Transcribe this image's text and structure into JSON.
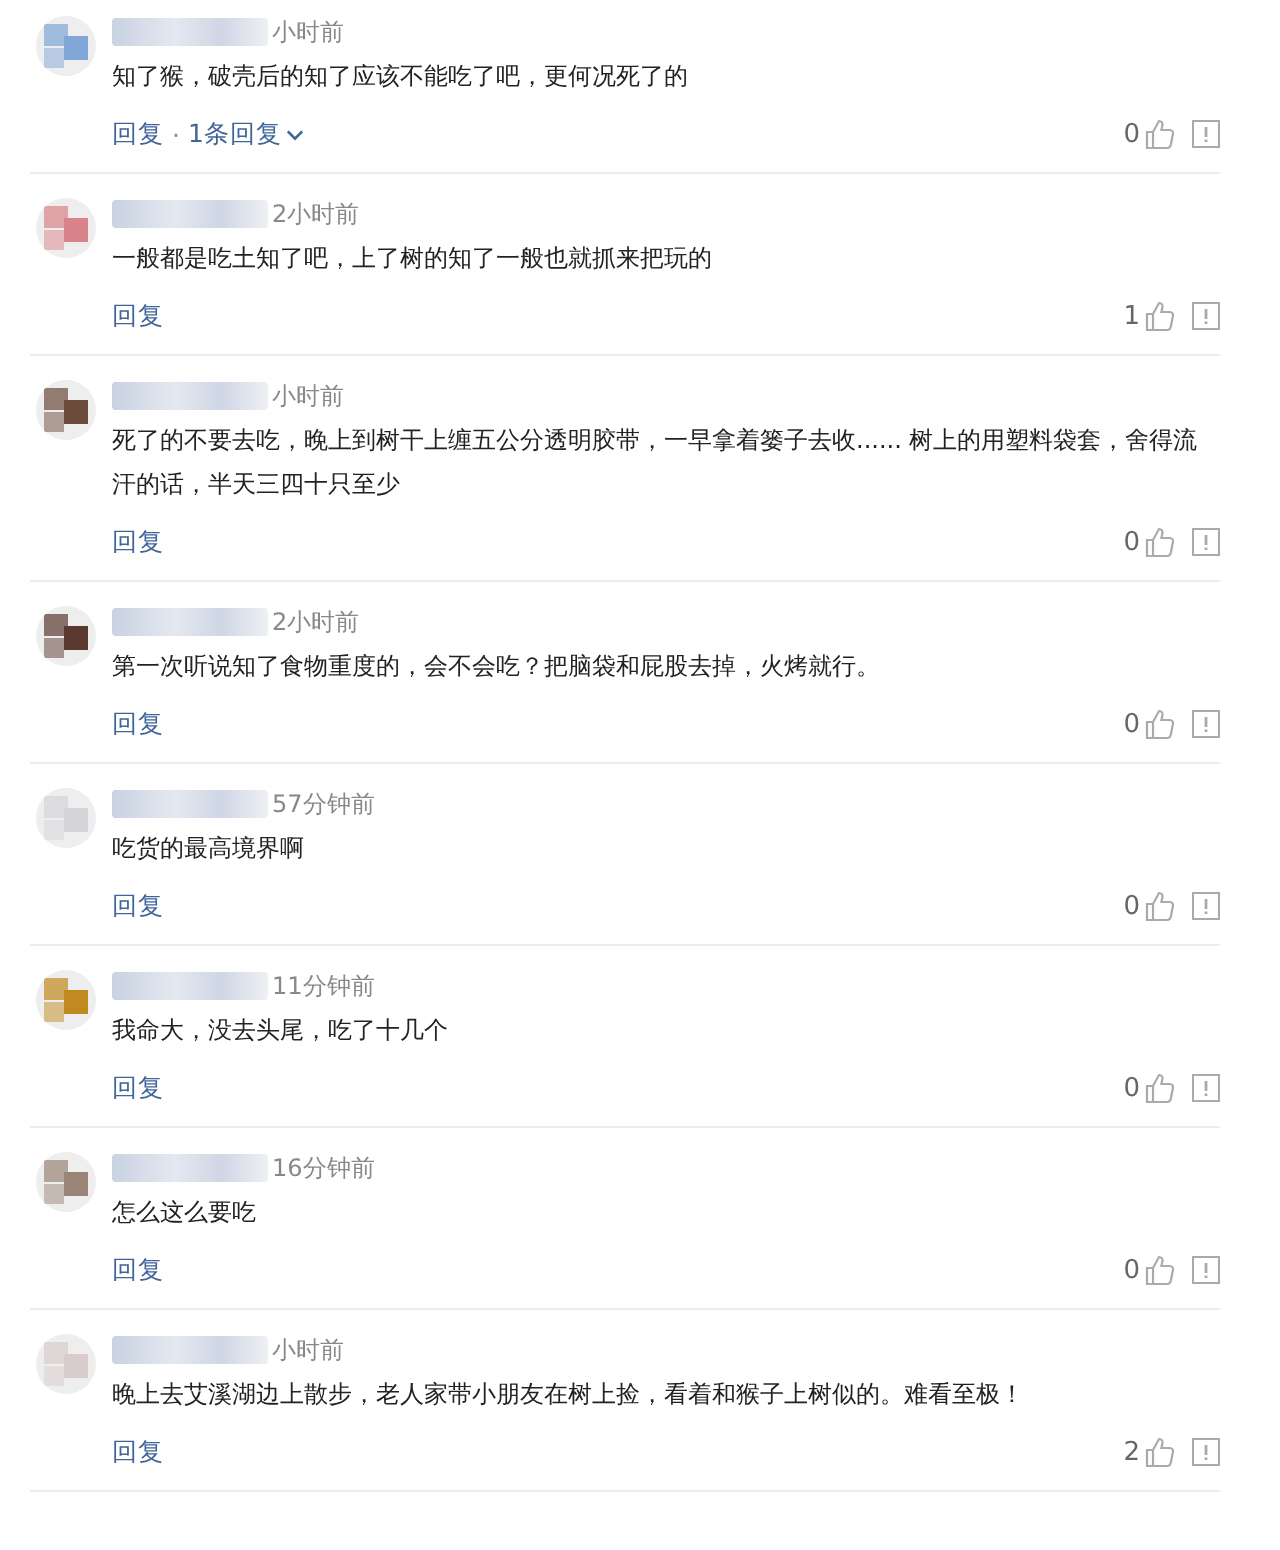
{
  "comments": [
    {
      "color": "#7fa6d6",
      "time": "小时前",
      "text": "知了猴，破壳后的知了应该不能吃了吧，更何况死了的",
      "reply": "回复",
      "separator": "·",
      "replies": "1条回复",
      "likes": "0"
    },
    {
      "color": "#d9848a",
      "time": "2小时前",
      "text": "一般都是吃土知了吧，上了树的知了一般也就抓来把玩的",
      "reply": "回复",
      "likes": "1"
    },
    {
      "color": "#6b4a3a",
      "time": "小时前",
      "text": "死了的不要去吃，晚上到树干上缠五公分透明胶带，一早拿着篓子去收...... 树上的用塑料袋套，舍得流汗的话，半天三四十只至少",
      "reply": "回复",
      "likes": "0"
    },
    {
      "color": "#5a3a30",
      "time": "2小时前",
      "text": "第一次听说知了食物重度的，会不会吃？把脑袋和屁股去掉，火烤就行。",
      "reply": "回复",
      "likes": "0"
    },
    {
      "color": "#d4d4d8",
      "time": "57分钟前",
      "text": "吃货的最高境界啊",
      "reply": "回复",
      "likes": "0"
    },
    {
      "color": "#c08a20",
      "time": "11分钟前",
      "text": "我命大，没去头尾，吃了十几个",
      "reply": "回复",
      "likes": "0"
    },
    {
      "color": "#9a8478",
      "time": "16分钟前",
      "text": "怎么这么要吃",
      "reply": "回复",
      "likes": "0"
    },
    {
      "color": "#d8cccc",
      "time": "小时前",
      "text": "晚上去艾溪湖边上散步，老人家带小朋友在树上捡，看着和猴子上树似的。难看至极！",
      "reply": "回复",
      "likes": "2"
    }
  ]
}
